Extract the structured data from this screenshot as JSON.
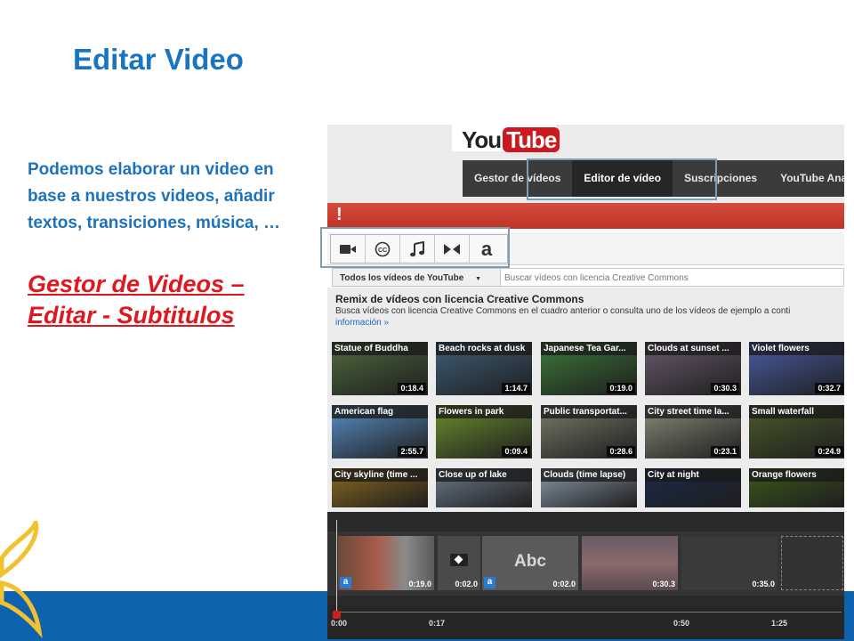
{
  "slide": {
    "title": "Editar Video",
    "body": "Podemos elaborar un video en base a nuestros videos, añadir textos, transiciones, música, …",
    "link_line1": "Gestor de Videos –",
    "link_line2": "Editar - Subtitulos"
  },
  "youtube": {
    "logo_you": "You",
    "logo_tube": "Tube",
    "nav": [
      "Gestor de vídeos",
      "Editor de vídeo",
      "Suscripciones",
      "YouTube Ana"
    ],
    "alert": "!",
    "tools": [
      "video-camera-icon",
      "closed-caption-icon",
      "music-note-icon",
      "transition-icon",
      "text-a-icon"
    ],
    "tool_a_glyph": "a",
    "filter_label": "Todos los vídeos de YouTube",
    "filter_arrow": "▼",
    "search_placeholder": "Buscar vídeos con licencia Creative Commons",
    "remix_title": "Remix de vídeos con licencia Creative Commons",
    "remix_desc": "Busca vídeos con licencia Creative Commons en el cuadro anterior o consulta uno de los vídeos de ejemplo a conti",
    "remix_more": "información »",
    "videos": [
      {
        "title": "Statue of Buddha",
        "duration": "0:18.4",
        "color": "#4f6b3f"
      },
      {
        "title": "Beach rocks at dusk",
        "duration": "1:14.7",
        "color": "#3f5f78"
      },
      {
        "title": "Japanese Tea Gar...",
        "duration": "0:19.0",
        "color": "#3d7a3a"
      },
      {
        "title": "Clouds at sunset ...",
        "duration": "0:30.3",
        "color": "#6a5a6e"
      },
      {
        "title": "Violet flowers",
        "duration": "0:32.7",
        "color": "#4a5ea8"
      },
      {
        "title": "American flag",
        "duration": "2:55.7",
        "color": "#5a8fc6"
      },
      {
        "title": "Flowers in park",
        "duration": "0:09.4",
        "color": "#6c8f2f"
      },
      {
        "title": "Public transportat...",
        "duration": "0:28.6",
        "color": "#7a7a6a"
      },
      {
        "title": "City street time la...",
        "duration": "0:23.1",
        "color": "#8a8a7a"
      },
      {
        "title": "Small waterfall",
        "duration": "0:24.9",
        "color": "#4a5a2a"
      },
      {
        "title": "City skyline (time ...",
        "duration": "",
        "color": "#8a6a20"
      },
      {
        "title": "Close up of lake",
        "duration": "",
        "color": "#6a7a8a"
      },
      {
        "title": "Clouds (time lapse)",
        "duration": "",
        "color": "#8a9aaa"
      },
      {
        "title": "City at night",
        "duration": "",
        "color": "#1a2a4a"
      },
      {
        "title": "Orange flowers",
        "duration": "",
        "color": "#3a5a1a"
      }
    ],
    "timeline": {
      "clips": [
        {
          "duration": "0:19.0",
          "badge": "a"
        },
        {
          "duration": "0:02.0",
          "badge": ""
        },
        {
          "label": "Abc",
          "duration": "0:02.0",
          "badge": "a"
        },
        {
          "duration": "0:30.3",
          "badge": ""
        },
        {
          "duration": "0:35.0",
          "badge": ""
        }
      ],
      "ticks": [
        "0:00",
        "0:17",
        "0:50",
        "1:25"
      ]
    }
  },
  "colors": {
    "title_blue": "#1a74c0",
    "link_red": "#e0171f",
    "band_blue": "#0f62ad",
    "youtube_red": "#cc181e"
  }
}
